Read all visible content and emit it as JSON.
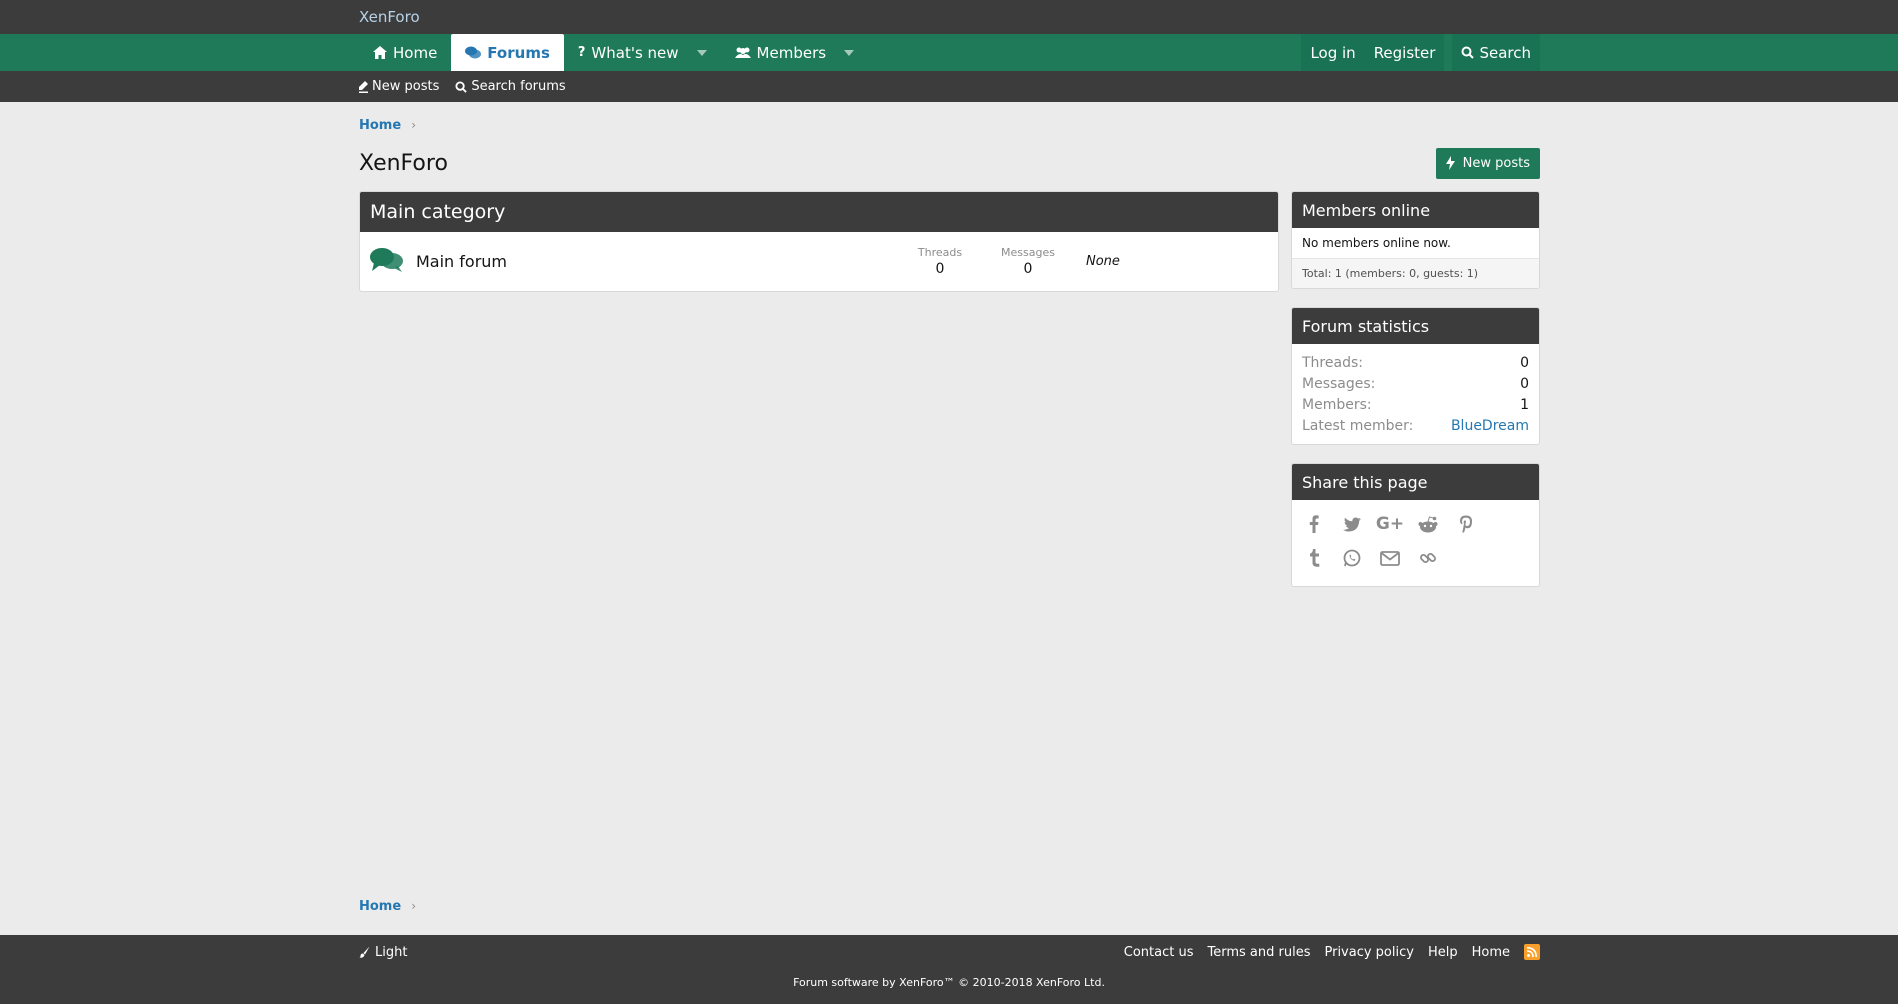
{
  "header": {
    "logo": "XenForo"
  },
  "nav": {
    "tabs": [
      {
        "label": "Home",
        "icon": "home-icon"
      },
      {
        "label": "Forums",
        "icon": "comments-icon",
        "active": true
      },
      {
        "label": "What's new",
        "icon": "question-icon"
      },
      {
        "label": "Members",
        "icon": "users-icon"
      }
    ],
    "login": "Log in",
    "register": "Register",
    "search": "Search"
  },
  "subnav": {
    "new_posts": "New posts",
    "search_forums": "Search forums"
  },
  "breadcrumb": {
    "home": "Home"
  },
  "page": {
    "title": "XenForo",
    "new_posts_button": "New posts"
  },
  "category": {
    "title": "Main category",
    "forums": [
      {
        "title": "Main forum",
        "threads_label": "Threads",
        "threads": "0",
        "messages_label": "Messages",
        "messages": "0",
        "last_post": "None"
      }
    ]
  },
  "sidebar": {
    "members_online": {
      "title": "Members online",
      "body": "No members online now.",
      "total": "Total: 1 (members: 0, guests: 1)"
    },
    "forum_statistics": {
      "title": "Forum statistics",
      "rows": [
        {
          "label": "Threads:",
          "value": "0"
        },
        {
          "label": "Messages:",
          "value": "0"
        },
        {
          "label": "Members:",
          "value": "1"
        },
        {
          "label": "Latest member:",
          "value": "BlueDream"
        }
      ]
    },
    "share": {
      "title": "Share this page",
      "icons": [
        "facebook-icon",
        "twitter-icon",
        "google-plus-icon",
        "reddit-icon",
        "pinterest-icon",
        "tumblr-icon",
        "whatsapp-icon",
        "email-icon",
        "link-icon"
      ]
    }
  },
  "footer": {
    "style": "Light",
    "links": [
      "Contact us",
      "Terms and rules",
      "Privacy policy",
      "Help",
      "Home"
    ],
    "copyright": "Forum software by XenForo™ © 2010-2018 XenForo Ltd."
  },
  "colors": {
    "nav": "#1f7a5a",
    "header": "#3c3c3c",
    "link": "#2577b1",
    "background": "#ebebeb"
  }
}
